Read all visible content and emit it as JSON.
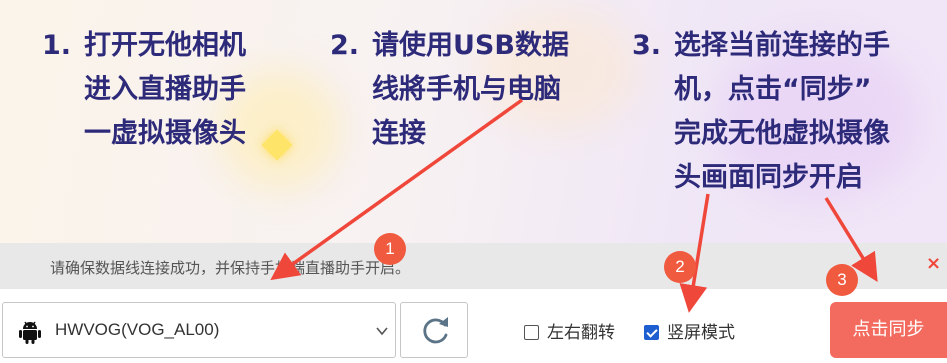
{
  "instructions": {
    "step1": {
      "num": "1.",
      "lines": [
        "打开无他相机",
        "进入直播助手",
        "一虚拟摄像头"
      ]
    },
    "step2": {
      "num": "2.",
      "lines": [
        "请使用USB数据",
        "线將手机与电脑",
        "连接"
      ]
    },
    "step3": {
      "num": "3.",
      "lines": [
        "选择当前连接的手",
        "机，点击“同步”",
        "完成无他虚拟摄像",
        "头画面同步开启"
      ]
    }
  },
  "notice": {
    "text": "请确保数据线连接成功，并保持手机端直播助手开启。",
    "close_glyph": "×"
  },
  "device": {
    "icon": "android-icon",
    "selected": "HWVOG(VOG_AL00)"
  },
  "options": {
    "flip_label": "左右翻转",
    "flip_checked": false,
    "portrait_label": "竖屏模式",
    "portrait_checked": true
  },
  "sync_button": {
    "label": "点击同步"
  },
  "badges": [
    "1",
    "2",
    "3"
  ],
  "colors": {
    "instruction_text": "#2d2a7a",
    "accent": "#f36b5e",
    "arrow": "#f0473b",
    "checkbox": "#1d5fd0"
  }
}
